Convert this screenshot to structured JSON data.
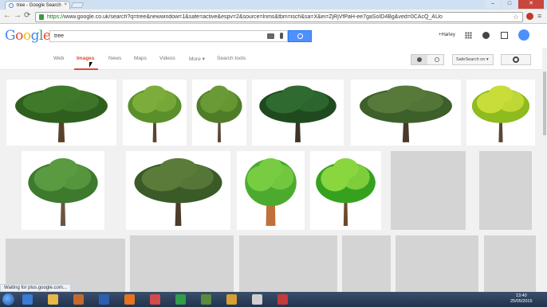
{
  "browser": {
    "tab_title": "tree - Google Search",
    "tab_close": "×",
    "controls": {
      "minimize": "–",
      "maximize": "□",
      "close": "✕"
    },
    "nav_back": "←",
    "nav_forward": "→",
    "reload": "⟳",
    "url_scheme": "https://",
    "url_rest": "www.google.co.uk/search?q=tree&newwindow=1&safe=active&espv=2&source=lnms&tbm=isch&sa=X&ei=ZjRjVfPaH-ee7gaSoID4Bg&ved=0CAcQ_AUo",
    "bookmark_icon": "☆",
    "menu_icon": "≡"
  },
  "google": {
    "logo_letters": [
      {
        "ch": "G",
        "color": "#4285f4"
      },
      {
        "ch": "o",
        "color": "#ea4335"
      },
      {
        "ch": "o",
        "color": "#fbbc05"
      },
      {
        "ch": "g",
        "color": "#4285f4"
      },
      {
        "ch": "l",
        "color": "#34a853"
      },
      {
        "ch": "e",
        "color": "#ea4335"
      }
    ],
    "search_value": "tree",
    "user_label": "+Harley"
  },
  "nav": {
    "items": [
      "Web",
      "Images",
      "News",
      "Maps",
      "Videos",
      "More ▾",
      "Search tools"
    ],
    "active": "Images",
    "safesearch_label": "SafeSearch on ▾"
  },
  "results": {
    "thumbnails": [
      {
        "kind": "tree-dark",
        "row": 1
      },
      {
        "kind": "tree-light",
        "row": 1
      },
      {
        "kind": "tree-round",
        "row": 1
      },
      {
        "kind": "tree-darkgreen",
        "row": 1
      },
      {
        "kind": "tree-wide",
        "row": 1
      },
      {
        "kind": "tree-yellow",
        "row": 1
      },
      {
        "kind": "tree-tall",
        "row": 2
      },
      {
        "kind": "tree-oak",
        "row": 2
      },
      {
        "kind": "tree-cartoon",
        "row": 2
      },
      {
        "kind": "tree-cartoon2",
        "row": 2
      },
      {
        "kind": "loading",
        "row": 2
      },
      {
        "kind": "loading",
        "row": 2
      },
      {
        "kind": "loading",
        "row": 3
      },
      {
        "kind": "loading",
        "row": 3
      },
      {
        "kind": "loading",
        "row": 3
      },
      {
        "kind": "loading",
        "row": 3
      },
      {
        "kind": "loading",
        "row": 3
      },
      {
        "kind": "loading",
        "row": 3
      }
    ]
  },
  "status_text": "Waiting for plus.google.com...",
  "taskbar": {
    "time": "13:40",
    "date": "25/05/2015",
    "icons": [
      "explorer",
      "folder",
      "cat-app",
      "media-player",
      "firefox",
      "search-app",
      "chrome",
      "minecraft",
      "media",
      "window",
      "flag"
    ]
  },
  "colors": {
    "accent_red": "#dd4b39",
    "search_blue": "#4d90fe"
  }
}
